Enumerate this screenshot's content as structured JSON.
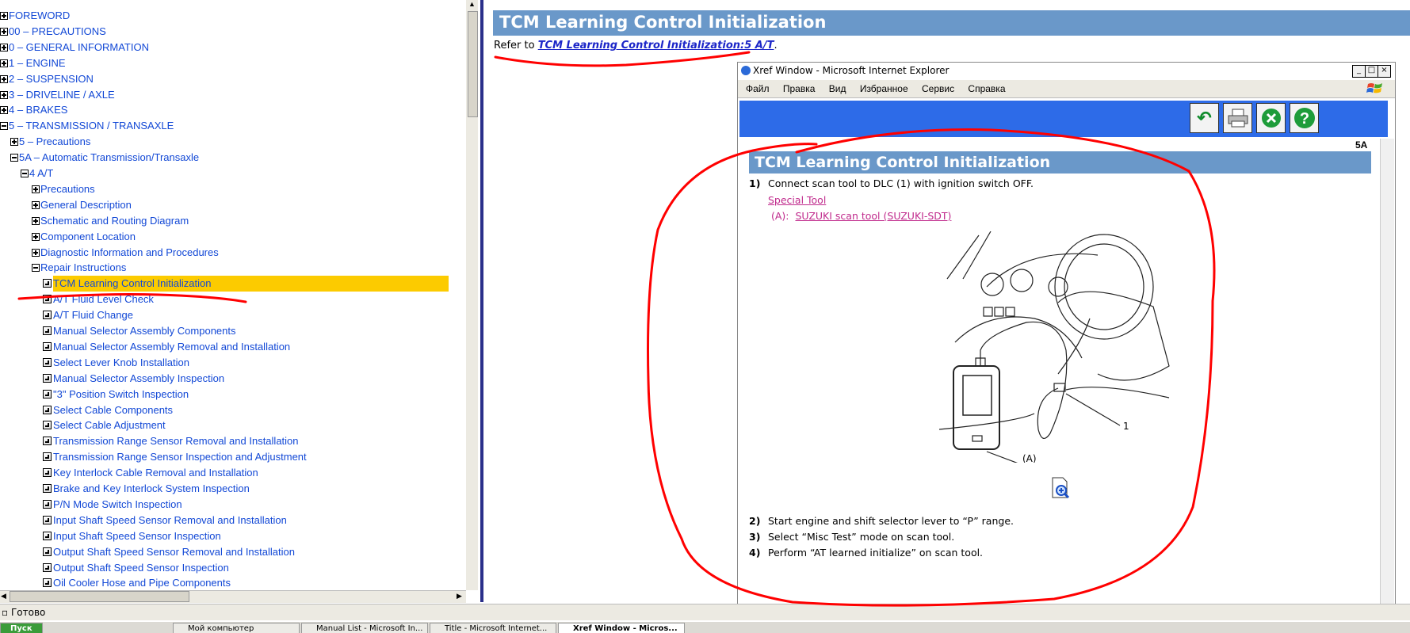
{
  "tree": {
    "items": [
      {
        "label": "FOREWORD",
        "kind": "plus"
      },
      {
        "label": "00 – PRECAUTIONS",
        "kind": "plus"
      },
      {
        "label": "0 – GENERAL INFORMATION",
        "kind": "plus"
      },
      {
        "label": "1 – ENGINE",
        "kind": "plus"
      },
      {
        "label": "2 – SUSPENSION",
        "kind": "plus"
      },
      {
        "label": "3 – DRIVELINE / AXLE",
        "kind": "plus"
      },
      {
        "label": "4 – BRAKES",
        "kind": "plus"
      },
      {
        "label": "5 – TRANSMISSION / TRANSAXLE",
        "kind": "minus"
      },
      {
        "label": "5 – Precautions",
        "kind": "plus"
      },
      {
        "label": "5A – Automatic Transmission/Transaxle",
        "kind": "minus"
      },
      {
        "label": "4 A/T",
        "kind": "minus"
      },
      {
        "label": "Precautions",
        "kind": "plus"
      },
      {
        "label": "General Description",
        "kind": "plus"
      },
      {
        "label": "Schematic and Routing Diagram",
        "kind": "plus"
      },
      {
        "label": "Component Location",
        "kind": "plus"
      },
      {
        "label": "Diagnostic Information and Procedures",
        "kind": "plus"
      },
      {
        "label": "Repair Instructions",
        "kind": "minus"
      },
      {
        "label": "TCM Learning Control Initialization",
        "kind": "doc",
        "selected": true
      },
      {
        "label": "A/T Fluid Level Check",
        "kind": "doc"
      },
      {
        "label": "A/T Fluid Change",
        "kind": "doc"
      },
      {
        "label": "Manual Selector Assembly Components",
        "kind": "doc"
      },
      {
        "label": "Manual Selector Assembly Removal and Installation",
        "kind": "doc"
      },
      {
        "label": "Select Lever Knob Installation",
        "kind": "doc"
      },
      {
        "label": "Manual Selector Assembly Inspection",
        "kind": "doc"
      },
      {
        "label": "\"3\" Position Switch Inspection",
        "kind": "doc"
      },
      {
        "label": "Select Cable Components",
        "kind": "doc"
      },
      {
        "label": "Select Cable Adjustment",
        "kind": "doc"
      },
      {
        "label": "Transmission Range Sensor Removal and Installation",
        "kind": "doc"
      },
      {
        "label": "Transmission Range Sensor Inspection and Adjustment",
        "kind": "doc"
      },
      {
        "label": "Key Interlock Cable Removal and Installation",
        "kind": "doc"
      },
      {
        "label": "Brake and Key Interlock System Inspection",
        "kind": "doc"
      },
      {
        "label": "P/N Mode Switch Inspection",
        "kind": "doc"
      },
      {
        "label": "Input Shaft Speed Sensor Removal and Installation",
        "kind": "doc"
      },
      {
        "label": "Input Shaft Speed Sensor Inspection",
        "kind": "doc"
      },
      {
        "label": "Output Shaft Speed Sensor Removal and Installation",
        "kind": "doc"
      },
      {
        "label": "Output Shaft Speed Sensor Inspection",
        "kind": "doc"
      },
      {
        "label": "Oil Cooler Hose and Pipe Components",
        "kind": "doc"
      }
    ]
  },
  "main": {
    "title": "TCM Learning Control Initialization",
    "refer_prefix": "Refer to ",
    "refer_link": "TCM Learning Control Initialization:5 A/T",
    "refer_suffix": "."
  },
  "xref": {
    "window_title": "Xref Window - Microsoft Internet Explorer",
    "menu": [
      "Файл",
      "Правка",
      "Вид",
      "Избранное",
      "Сервис",
      "Справка"
    ],
    "toolbar": {
      "back": "back-arrow-icon",
      "print": "printer-icon",
      "close": "close-icon",
      "help": "help-icon"
    },
    "section_code": "5A",
    "section_title": "TCM Learning Control Initialization",
    "steps": [
      {
        "num": "1)",
        "text": "Connect scan tool to DLC (1) with ignition switch OFF."
      },
      {
        "num": "2)",
        "text": "Start engine and shift selector lever to “P” range."
      },
      {
        "num": "3)",
        "text": "Select “Misc Test” mode on scan tool."
      },
      {
        "num": "4)",
        "text": "Perform “AT learned initialize” on scan tool."
      }
    ],
    "special_tool_label": "Special Tool",
    "special_tool_prefix": "(A):",
    "special_tool_name": "SUZUKI scan tool (SUZUKI-SDT)",
    "illus_label_a": "(A)",
    "illus_label_1": "1"
  },
  "status": {
    "text": "Готово"
  },
  "taskbar": {
    "start": "Пуск",
    "tasks": [
      "Мой компьютер",
      "Manual List - Microsoft In...",
      "Title - Microsoft Internet...",
      "Xref Window - Micros..."
    ]
  },
  "colors": {
    "accent_bar": "#6a98c9",
    "link": "#1248d6",
    "highlight": "#fccb00",
    "annotation": "#ff0000",
    "toolbar": "#2d6be8"
  }
}
